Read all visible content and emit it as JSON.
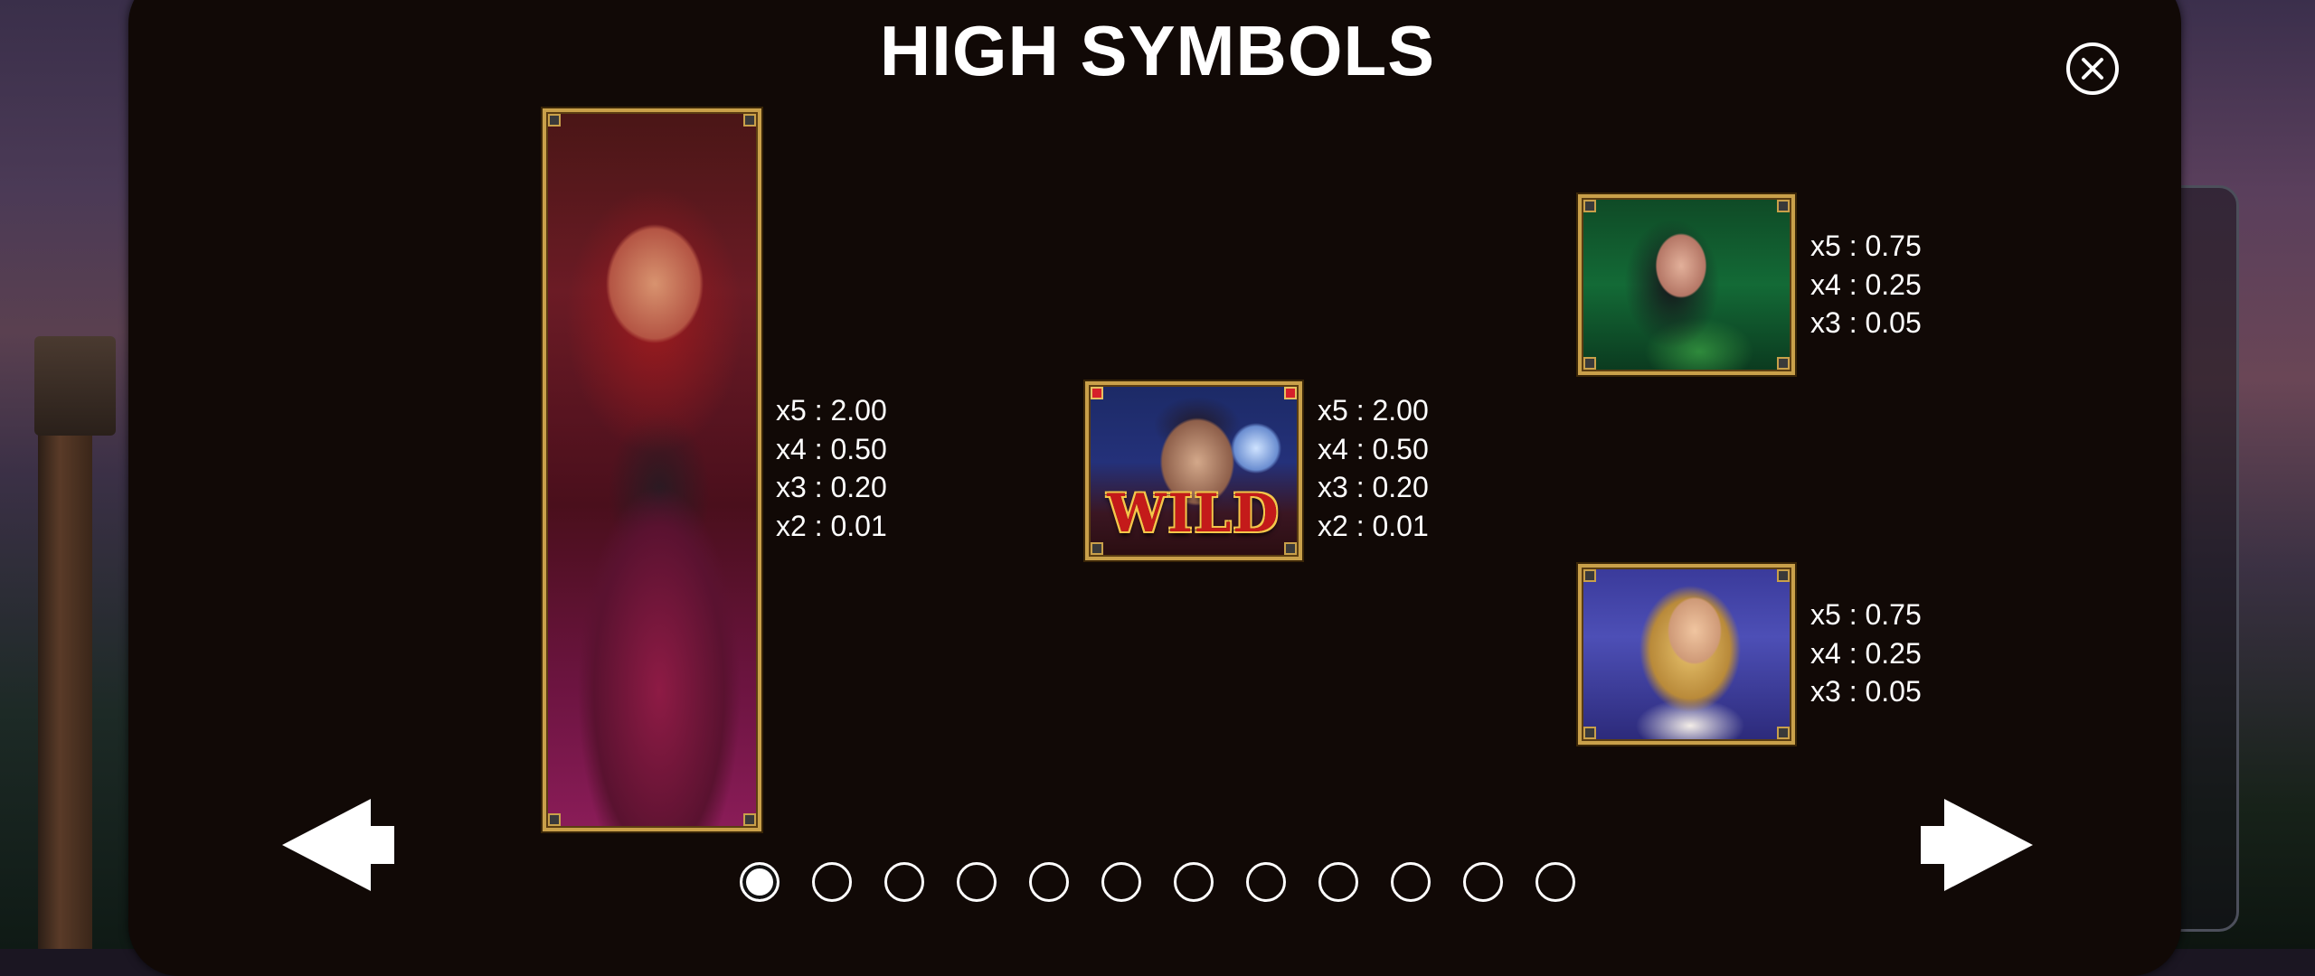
{
  "title": "HIGH SYMBOLS",
  "colors": {
    "dialog_bg": "#110906",
    "card_border": "#c9a04a",
    "text": "#ffffff",
    "wild_text": "#c41a1a"
  },
  "symbols": {
    "red_lady": {
      "icon": "red-dress-lady-symbol",
      "pays": [
        "x5 : 2.00",
        "x4 : 0.50",
        "x3 : 0.20",
        "x2 : 0.01"
      ]
    },
    "wild": {
      "icon": "vampire-wild-symbol",
      "label": "WILD",
      "pays": [
        "x5 : 2.00",
        "x4 : 0.50",
        "x3 : 0.20",
        "x2 : 0.01"
      ]
    },
    "green_lady": {
      "icon": "green-dress-lady-symbol",
      "pays": [
        "x5 : 0.75",
        "x4 : 0.25",
        "x3 : 0.05"
      ]
    },
    "blonde_lady": {
      "icon": "blonde-lady-symbol",
      "pays": [
        "x5 : 0.75",
        "x4 : 0.25",
        "x3 : 0.05"
      ]
    }
  },
  "navigation": {
    "prev_icon": "arrow-left-icon",
    "next_icon": "arrow-right-icon",
    "close_icon": "close-icon",
    "pages_total": 12,
    "current_page": 1
  }
}
